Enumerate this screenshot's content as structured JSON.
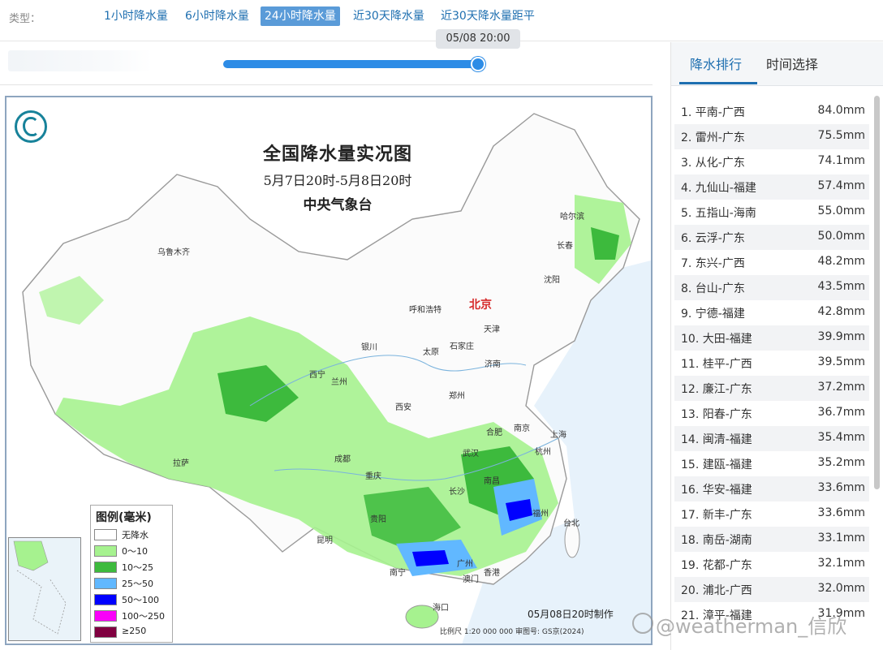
{
  "type_bar": {
    "label": "类型：",
    "tabs": [
      {
        "label": "1小时降水量",
        "active": false
      },
      {
        "label": "6小时降水量",
        "active": false
      },
      {
        "label": "24小时降水量",
        "active": true
      },
      {
        "label": "近30天降水量",
        "active": false
      },
      {
        "label": "近30天降水量距平",
        "active": false
      }
    ]
  },
  "time_slider": {
    "current": "05/08 20:00",
    "progress": 1.0
  },
  "map": {
    "title": "全国降水量实况图",
    "period": "5月7日20时-5月8日20时",
    "issuer": "中央气象台",
    "made": "05月08日20时制作",
    "scale": "比例尺 1:20 000 000   审图号: GS京(2024)",
    "capital": "北京",
    "cities": [
      "乌鲁木齐",
      "哈尔滨",
      "长春",
      "沈阳",
      "呼和浩特",
      "天津",
      "石家庄",
      "太原",
      "银川",
      "西宁",
      "兰州",
      "济南",
      "郑州",
      "西安",
      "合肥",
      "南京",
      "上海",
      "杭州",
      "武汉",
      "成都",
      "重庆",
      "拉萨",
      "长沙",
      "南昌",
      "福州",
      "台北",
      "贵阳",
      "昆明",
      "南宁",
      "广州",
      "澳门",
      "香港",
      "海口"
    ],
    "legend": {
      "title": "图例(毫米)",
      "items": [
        {
          "label": "无降水",
          "color": "#ffffff"
        },
        {
          "label": "0～10",
          "color": "#a6f28f"
        },
        {
          "label": "10～25",
          "color": "#3dba3d"
        },
        {
          "label": "25～50",
          "color": "#61b8ff"
        },
        {
          "label": "50～100",
          "color": "#0000ff"
        },
        {
          "label": "100～250",
          "color": "#fa00fa"
        },
        {
          "label": "≥250",
          "color": "#800040"
        }
      ]
    }
  },
  "panel": {
    "tabs": [
      {
        "label": "降水排行",
        "active": true
      },
      {
        "label": "时间选择",
        "active": false
      }
    ],
    "ranking": [
      {
        "name": "1. 平南-广西",
        "value": "84.0mm"
      },
      {
        "name": "2. 雷州-广东",
        "value": "75.5mm"
      },
      {
        "name": "3. 从化-广东",
        "value": "74.1mm"
      },
      {
        "name": "4. 九仙山-福建",
        "value": "57.4mm"
      },
      {
        "name": "5. 五指山-海南",
        "value": "55.0mm"
      },
      {
        "name": "6. 云浮-广东",
        "value": "50.0mm"
      },
      {
        "name": "7. 东兴-广西",
        "value": "48.2mm"
      },
      {
        "name": "8. 台山-广东",
        "value": "43.5mm"
      },
      {
        "name": "9. 宁德-福建",
        "value": "42.8mm"
      },
      {
        "name": "10. 大田-福建",
        "value": "39.9mm"
      },
      {
        "name": "11. 桂平-广西",
        "value": "39.5mm"
      },
      {
        "name": "12. 廉江-广东",
        "value": "37.2mm"
      },
      {
        "name": "13. 阳春-广东",
        "value": "36.7mm"
      },
      {
        "name": "14. 闽清-福建",
        "value": "35.4mm"
      },
      {
        "name": "15. 建瓯-福建",
        "value": "35.2mm"
      },
      {
        "name": "16. 华安-福建",
        "value": "33.6mm"
      },
      {
        "name": "17. 新丰-广东",
        "value": "33.6mm"
      },
      {
        "name": "18. 南岳-湖南",
        "value": "33.1mm"
      },
      {
        "name": "19. 花都-广东",
        "value": "32.1mm"
      },
      {
        "name": "20. 浦北-广西",
        "value": "32.0mm"
      },
      {
        "name": "21. 漳平-福建",
        "value": "31.9mm"
      }
    ]
  },
  "watermark": "@weatherman_信欣"
}
